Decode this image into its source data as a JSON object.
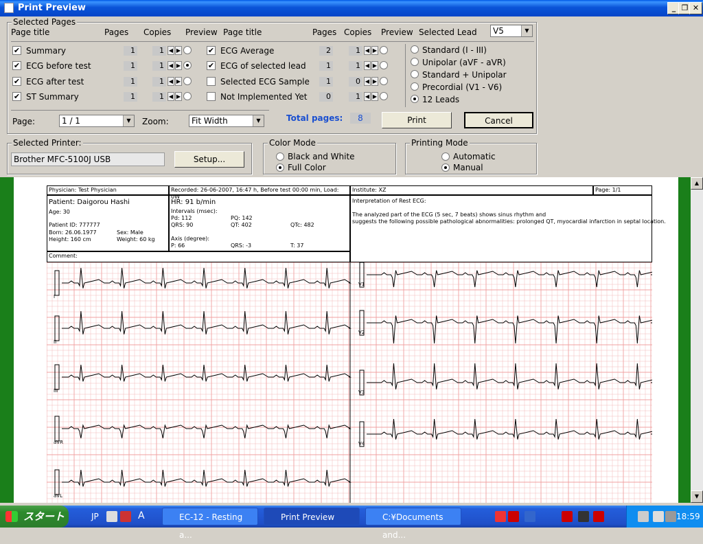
{
  "window": {
    "title": "Print Preview"
  },
  "selected_pages": {
    "legend": "Selected Pages",
    "headers": {
      "page_title": "Page title",
      "pages": "Pages",
      "copies": "Copies",
      "preview": "Preview",
      "selected_lead": "Selected Lead"
    },
    "left_rows": [
      {
        "label": "Summary",
        "checked": true,
        "pages": "1",
        "copies": "1",
        "preview": false
      },
      {
        "label": "ECG before test",
        "checked": true,
        "pages": "1",
        "copies": "1",
        "preview": true
      },
      {
        "label": "ECG after test",
        "checked": true,
        "pages": "1",
        "copies": "1",
        "preview": false
      },
      {
        "label": "ST Summary",
        "checked": true,
        "pages": "1",
        "copies": "1",
        "preview": false
      }
    ],
    "right_rows": [
      {
        "label": "ECG Average",
        "checked": true,
        "pages": "2",
        "copies": "1",
        "preview": false
      },
      {
        "label": "ECG of selected lead",
        "checked": true,
        "pages": "1",
        "copies": "1",
        "preview": false
      },
      {
        "label": "Selected ECG Sample",
        "checked": false,
        "pages": "1",
        "copies": "0",
        "preview": false
      },
      {
        "label": "Not Implemented Yet",
        "checked": false,
        "pages": "0",
        "copies": "1",
        "preview": false
      }
    ],
    "lead_value": "V5",
    "lead_options": [
      {
        "label": "Standard (I - III)",
        "checked": false
      },
      {
        "label": "Unipolar (aVF - aVR)",
        "checked": false
      },
      {
        "label": "Standard + Unipolar",
        "checked": false
      },
      {
        "label": "Precordial (V1 - V6)",
        "checked": false
      },
      {
        "label": "12 Leads",
        "checked": true
      }
    ],
    "page_label": "Page:",
    "page_value": "1 / 1",
    "zoom_label": "Zoom:",
    "zoom_value": "Fit Width",
    "total_label": "Total pages:",
    "total_value": "8",
    "print_label": "Print",
    "cancel_label": "Cancel"
  },
  "printer": {
    "legend": "Selected Printer:",
    "name": "Brother MFC-5100J USB",
    "setup_label": "Setup..."
  },
  "color_mode": {
    "legend": "Color Mode",
    "options": [
      {
        "label": "Black and White",
        "checked": false
      },
      {
        "label": "Full Color",
        "checked": true
      }
    ]
  },
  "printing_mode": {
    "legend": "Printing Mode",
    "options": [
      {
        "label": "Automatic",
        "checked": false
      },
      {
        "label": "Manual",
        "checked": true
      }
    ]
  },
  "report": {
    "physician": "Physician: Test Physician",
    "recorded": "Recorded: 26-06-2007, 16:47 h, Before test 00:00 min, Load: 0W",
    "institute": "Institute: XZ",
    "page": "Page: 1/1",
    "patient": "Patient: Daigorou Hashi",
    "age": "Age: 30",
    "patient_id": "Patient ID: 777777",
    "born": "Born: 26.06.1977",
    "sex": "Sex: Male",
    "height": "Height: 160 cm",
    "weight": "Weight: 60 kg",
    "hr": "HR: 91 b/min",
    "intervals_title": "Intervals (msec):",
    "pd": "Pd: 112",
    "pq": "PQ: 142",
    "qrs": "QRS: 90",
    "qt": "QT: 402",
    "qtc": "QTc: 482",
    "axis_title": "Axis (degree):",
    "axis_p": "P: 66",
    "axis_qrs": "QRS: -3",
    "axis_t": "T: 37",
    "interp_title": "Interpretation of Rest ECG:",
    "interp_line1": "The analyzed part of the ECG (5 sec, 7 beats) shows sinus rhythm and",
    "interp_line2": "suggests the following possible pathological abnormalities: prolonged QT, myocardial infarction in septal location.",
    "comment": "Comment:",
    "leads_left": [
      "I",
      "II",
      "III",
      "aVR",
      "aVL"
    ],
    "leads_right": [
      "V1",
      "V2",
      "V3",
      "V4"
    ]
  },
  "taskbar": {
    "start": "スタート",
    "lang": "JP",
    "tasks": [
      "EC-12 - Resting a...",
      "Print Preview",
      "C:¥Documents and..."
    ],
    "clock": "18:59"
  }
}
